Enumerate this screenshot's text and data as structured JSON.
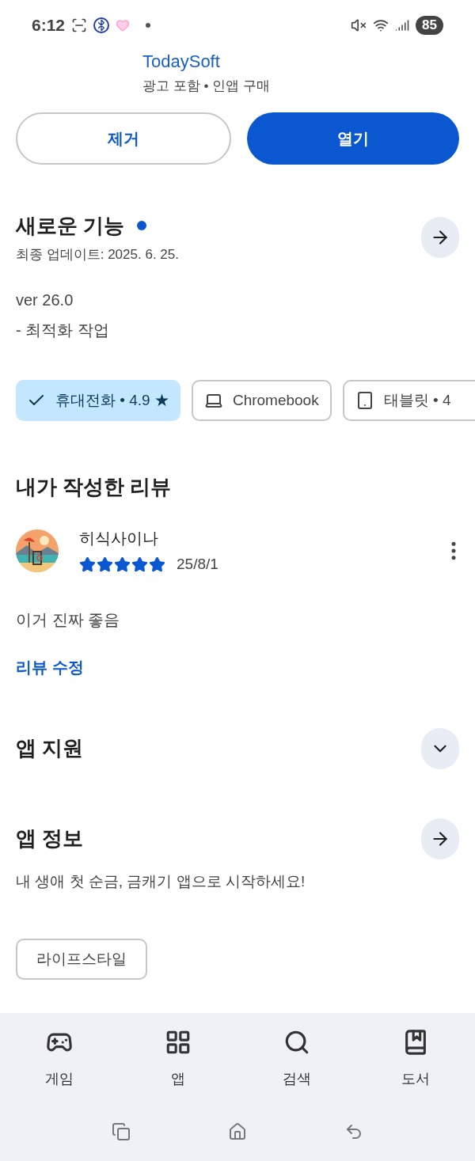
{
  "status_bar": {
    "time": "6:12",
    "battery": "85"
  },
  "developer": {
    "name": "TodaySoft",
    "notes": "광고 포함 • 인앱 구매"
  },
  "actions": [
    {
      "label": "제거",
      "kind": "outline"
    },
    {
      "label": "열기",
      "kind": "filled"
    }
  ],
  "whats_new": {
    "title": "새로운 기능",
    "unread": true,
    "updated": "최종 업데이트: 2025. 6. 25.",
    "version": "ver 26.0",
    "notes": "- 최적화 작업"
  },
  "devices": [
    {
      "label": "휴대전화 • 4.9 ★",
      "kind": "phone",
      "selected": true
    },
    {
      "label": "Chromebook",
      "kind": "laptop",
      "selected": false
    },
    {
      "label": "태블릿 • 4",
      "kind": "tablet",
      "selected": false
    }
  ],
  "my_review": {
    "title": "내가 작성한 리뷰",
    "author": "히식사이나",
    "stars": 5,
    "date": "25/8/1",
    "text": "이거 진짜 좋음",
    "edit_link": "리뷰 수정"
  },
  "sections": [
    {
      "title": "앱 지원",
      "kind": "expand"
    },
    {
      "title": "앱 정보",
      "kind": "arrow",
      "description": "내 생애 첫 순금, 금캐기 앱으로 시작하세요!"
    }
  ],
  "tags": [
    "라이프스타일"
  ],
  "bottom_nav": [
    {
      "label": "게임",
      "kind": "games",
      "selected": false
    },
    {
      "label": "앱",
      "kind": "apps",
      "selected": false
    },
    {
      "label": "검색",
      "kind": "search",
      "selected": false
    },
    {
      "label": "도서",
      "kind": "books",
      "selected": false
    }
  ]
}
